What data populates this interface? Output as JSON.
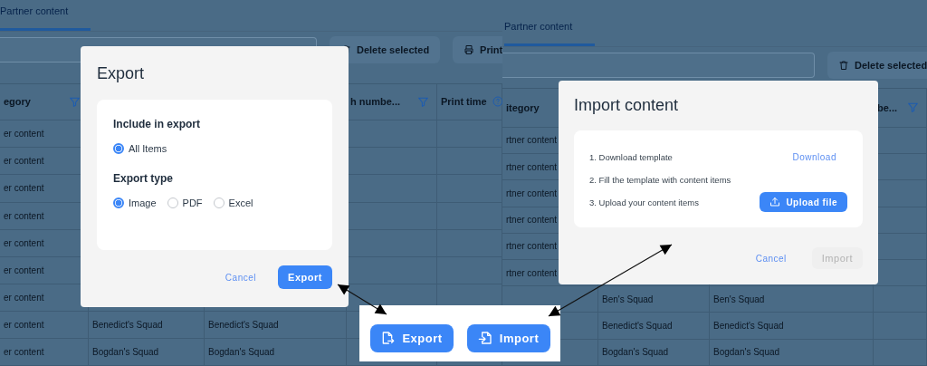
{
  "left_screen": {
    "tab": {
      "label": "Partner content",
      "selected": true
    },
    "toolbar": [
      {
        "label": "Delete selected",
        "kind": "delete"
      },
      {
        "label": "Print",
        "kind": "print"
      }
    ],
    "columns": [
      {
        "label": "egory",
        "filter": true,
        "help": false
      },
      null,
      null,
      {
        "label": "h numbe...",
        "filter": true,
        "help": false
      },
      {
        "label": "Print time",
        "filter": false,
        "help": true
      }
    ],
    "rows": [
      [
        "er content"
      ],
      [
        "er content"
      ],
      [
        "er content"
      ],
      [
        "er content"
      ],
      [
        "er content"
      ],
      [
        "er content"
      ],
      [
        "er content"
      ],
      [
        "er content",
        "Benedict's Squad",
        "Benedict's Squad"
      ],
      [
        "er content",
        "Bogdan's Squad",
        "Bogdan's Squad"
      ]
    ]
  },
  "right_screen": {
    "tab": {
      "label": "Partner content",
      "selected": true
    },
    "toolbar": [
      {
        "label": "Delete selected",
        "kind": "delete"
      }
    ],
    "columns": [
      {
        "label": "itegory"
      },
      null,
      null,
      {
        "label": "be...",
        "filter": true,
        "help": false
      }
    ],
    "rows": [
      [
        "rtner content"
      ],
      [
        "rtner content"
      ],
      [
        "rtner content"
      ],
      [
        "rtner content"
      ],
      [
        "rtner content"
      ],
      [
        "rtner content"
      ],
      [
        "",
        "Ben's Squad",
        "Ben's Squad"
      ],
      [
        "",
        "Benedict's Squad",
        "Benedict's Squad"
      ],
      [
        "",
        "Bogdan's Squad",
        "Bogdan's Squad"
      ]
    ]
  },
  "export_dialog": {
    "title": "Export",
    "sections": [
      {
        "heading": "Include in export",
        "options": [
          {
            "label": "All Items",
            "selected": true
          }
        ]
      },
      {
        "heading": "Export type",
        "options": [
          {
            "label": "Image",
            "selected": true
          },
          {
            "label": "PDF",
            "selected": false
          },
          {
            "label": "Excel",
            "selected": false
          }
        ]
      }
    ],
    "cancel": "Cancel",
    "confirm": {
      "label": "Export",
      "disabled": false
    }
  },
  "import_dialog": {
    "title": "Import content",
    "steps": [
      {
        "text": "1. Download template",
        "action": {
          "kind": "link",
          "label": "Download"
        }
      },
      {
        "text": "2. Fill the template with content items"
      },
      {
        "text": "3. Upload your content items",
        "action": {
          "kind": "button",
          "label": "Upload file"
        }
      }
    ],
    "cancel": "Cancel",
    "confirm": {
      "label": "Import",
      "disabled": true
    }
  },
  "button_panel": [
    {
      "label": "Export",
      "kind": "export"
    },
    {
      "label": "Import",
      "kind": "import"
    }
  ]
}
